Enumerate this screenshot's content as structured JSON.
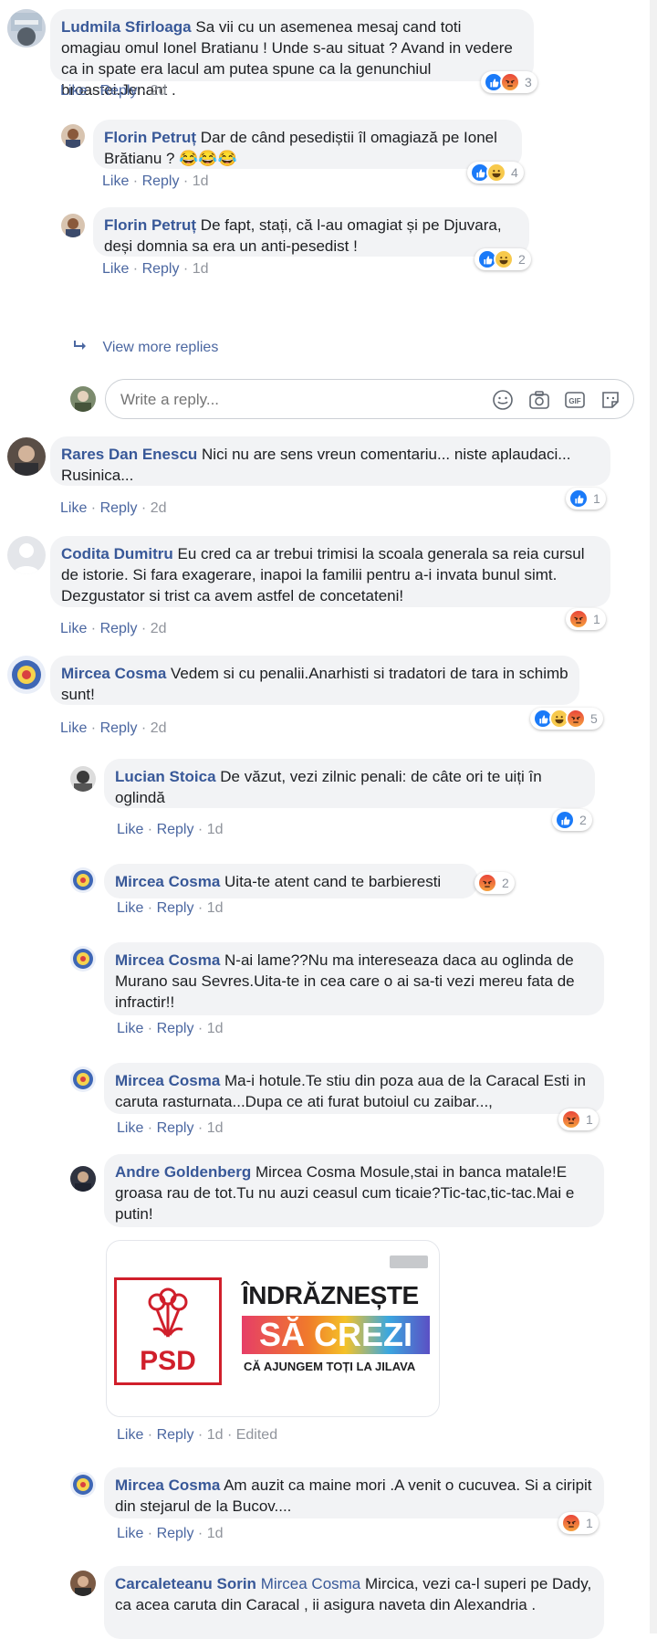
{
  "actions": {
    "like": "Like",
    "reply": "Reply",
    "sep": " · "
  },
  "write_reply": {
    "placeholder": "Write a reply..."
  },
  "view_more": {
    "label": "View more replies"
  },
  "comments": [
    {
      "author": "Ludmila Sfirloaga",
      "text": "Sa vii cu un asemenea mesaj cand toti omagiau omul Ionel Bratianu ! Unde s-au situat ? Avand in vedere ca in spate era lacul am putea spune ca la genunchiul broastei.Jenant .",
      "time": "2d",
      "reaction_count": "3"
    },
    {
      "author": "Florin Petruț",
      "text": "Dar de când pesediștii îl omagiază pe Ionel Brătianu ? 😂😂😂",
      "time": "1d",
      "reaction_count": "4"
    },
    {
      "author": "Florin Petruț",
      "text": "De fapt, stați, că l-au omagiat și pe Djuvara, deși domnia sa era un anti-pesedist !",
      "time": "1d",
      "reaction_count": "2"
    },
    {
      "author": "Rares Dan Enescu",
      "text": "Nici nu are sens vreun comentariu... niste aplaudaci... Rusinica...",
      "time": "2d",
      "reaction_count": "1"
    },
    {
      "author": "Codita Dumitru",
      "text": "Eu cred ca ar trebui trimisi la scoala generala sa reia cursul de istorie. Si fara exagerare, inapoi la familii pentru a-i invata bunul simt. Dezgustator si trist ca avem astfel de concetateni!",
      "time": "2d",
      "reaction_count": "1"
    },
    {
      "author": "Mircea Cosma",
      "text": "Vedem si cu penalii.Anarhisti si tradatori de tara in schimb sunt!",
      "time": "2d",
      "reaction_count": "5"
    },
    {
      "author": "Lucian Stoica",
      "text": "De văzut, vezi zilnic penali: de câte ori te uiți în oglindă",
      "time": "1d",
      "reaction_count": "2"
    },
    {
      "author": "Mircea Cosma",
      "text": "Uita-te atent cand te barbieresti",
      "time": "1d",
      "reaction_count": "2"
    },
    {
      "author": "Mircea Cosma",
      "text": "N-ai lame??Nu ma intereseaza daca au oglinda de Murano sau Sevres.Uita-te in cea care o ai sa-ti vezi mereu fata de infractir!!",
      "time": "1d"
    },
    {
      "author": "Mircea Cosma",
      "text": "Ma-i hotule.Te stiu din poza aua de la Caracal Esti in caruta rasturnata...Dupa ce ati furat butoiul cu zaibar...,",
      "time": "1d",
      "reaction_count": "1"
    },
    {
      "author": "Andre Goldenberg",
      "text": "Mircea Cosma Mosule,stai in banca matale!E groasa rau de tot.Tu nu auzi ceasul cum ticaie?Tic-tac,tic-tac.Mai e putin!",
      "time": "1d",
      "edited": "Edited"
    },
    {
      "author": "Mircea Cosma",
      "text": "Am auzit ca maine mori .A venit o cucuvea. Si a ciripit din stejarul de la Bucov....",
      "time": "1d",
      "reaction_count": "1"
    },
    {
      "author": "Carcaleteanu Sorin",
      "mention": "Mircea Cosma",
      "text": "Mircica, vezi ca-l superi pe Dady, ca acea caruta din Caracal , ii asigura naveta din Alexandria ."
    }
  ],
  "image": {
    "logo": "PSD",
    "line1": "ÎNDRĂZNEȘTE",
    "line2": "SĂ CREZI",
    "line3": "CĂ AJUNGEM TOȚI LA JILAVA"
  },
  "colors": {
    "name": "#385898",
    "link": "#4b67a1",
    "meta": "#90949c",
    "bubble": "#f2f3f5",
    "like": "#1a7af8",
    "psd_red": "#d01f2b"
  }
}
